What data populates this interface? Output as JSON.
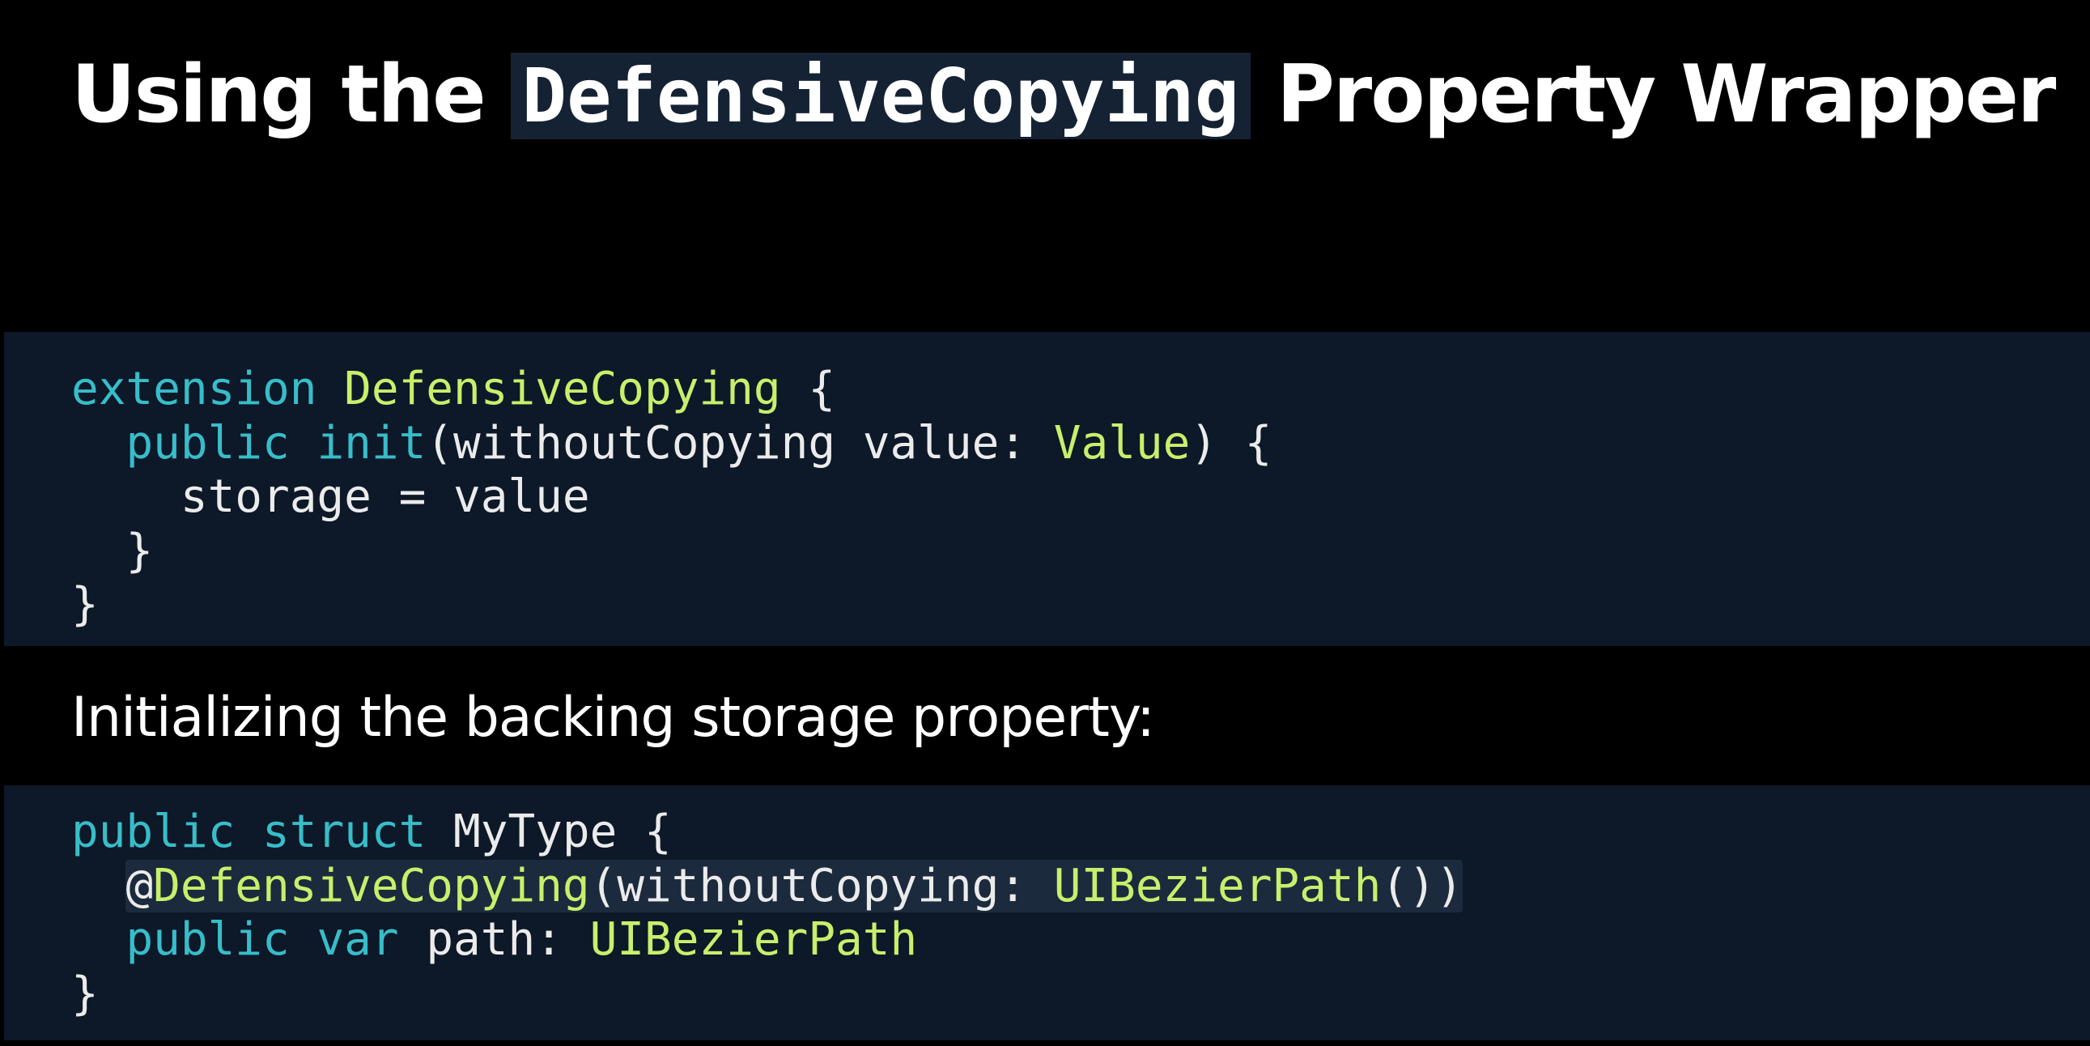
{
  "title": {
    "prefix": "Using the",
    "code": "DefensiveCopying",
    "suffix": "Property Wrapper"
  },
  "code_block_1": {
    "line1": {
      "kw": "extension",
      "type": "DefensiveCopying",
      "rest": "{"
    },
    "line2": {
      "kw1": "public",
      "kw2": "init",
      "rest": "(withoutCopying value:",
      "type": "Value",
      "end": ") {"
    },
    "line3": {
      "text": "storage = value"
    },
    "line4": {
      "text": "}"
    },
    "line5": {
      "text": "}"
    }
  },
  "subtitle": "Initializing the backing storage property:",
  "code_block_2": {
    "line1": {
      "kw1": "public",
      "kw2": "struct",
      "rest": "MyType {"
    },
    "line2": {
      "at": "@",
      "type": "DefensiveCopying",
      "rest": "(withoutCopying:",
      "type2": "UIBezierPath",
      "end": "())"
    },
    "line3": {
      "kw1": "public",
      "kw2": "var",
      "rest": "path:",
      "type": "UIBezierPath"
    },
    "line4": {
      "text": "}"
    }
  },
  "colors": {
    "background": "#000000",
    "code_panel": "#0d1828",
    "keyword": "#37bdc9",
    "type": "#c8ef6b",
    "text": "#ebebeb"
  }
}
